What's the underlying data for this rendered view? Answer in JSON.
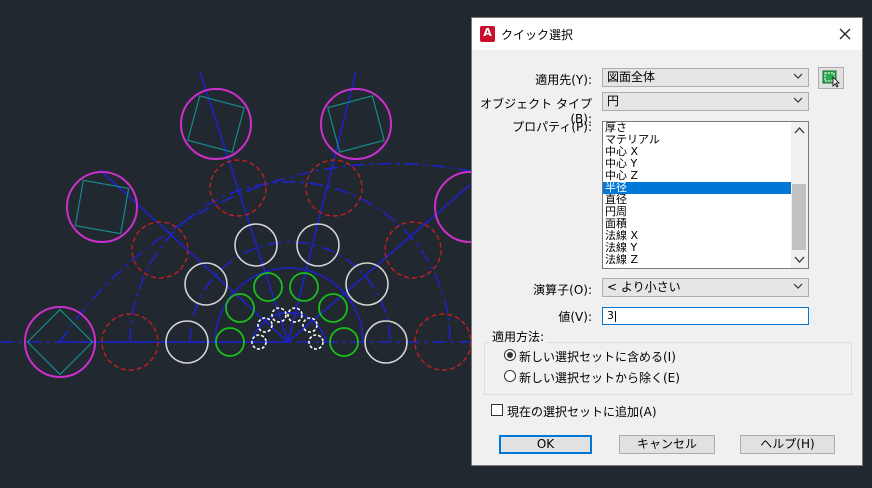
{
  "dialog": {
    "title": "クイック選択",
    "apply_to": {
      "label": "適用先(Y):",
      "value": "図面全体"
    },
    "object_type": {
      "label": "オブジェクト タイプ(B):",
      "value": "円"
    },
    "properties": {
      "label": "プロパティ(P):",
      "items": [
        "厚さ",
        "マテリアル",
        "中心 X",
        "中心 Y",
        "中心 Z",
        "半径",
        "直径",
        "円周",
        "面積",
        "法線 X",
        "法線 Y",
        "法線 Z"
      ],
      "selected": "半径"
    },
    "operator": {
      "label": "演算子(O):",
      "value": "< より小さい"
    },
    "value": {
      "label": "値(V):",
      "value": "3"
    },
    "apply_method": {
      "title": "適用方法:",
      "include_label": "新しい選択セットに含める(I)",
      "exclude_label": "新しい選択セットから除く(E)",
      "selected": "include"
    },
    "append": {
      "label": "現在の選択セットに追加(A)",
      "checked": false
    },
    "buttons": {
      "ok": "OK",
      "cancel": "キャンセル",
      "help": "ヘルプ(H)"
    }
  },
  "colors": {
    "canvas_bg": "#212830",
    "construction_blue": "#1e22c8",
    "magenta": "#cc2fcc",
    "red_dashed": "#c02020",
    "white": "#d4d4d4",
    "green": "#18c018",
    "selection": "#0078d7"
  }
}
